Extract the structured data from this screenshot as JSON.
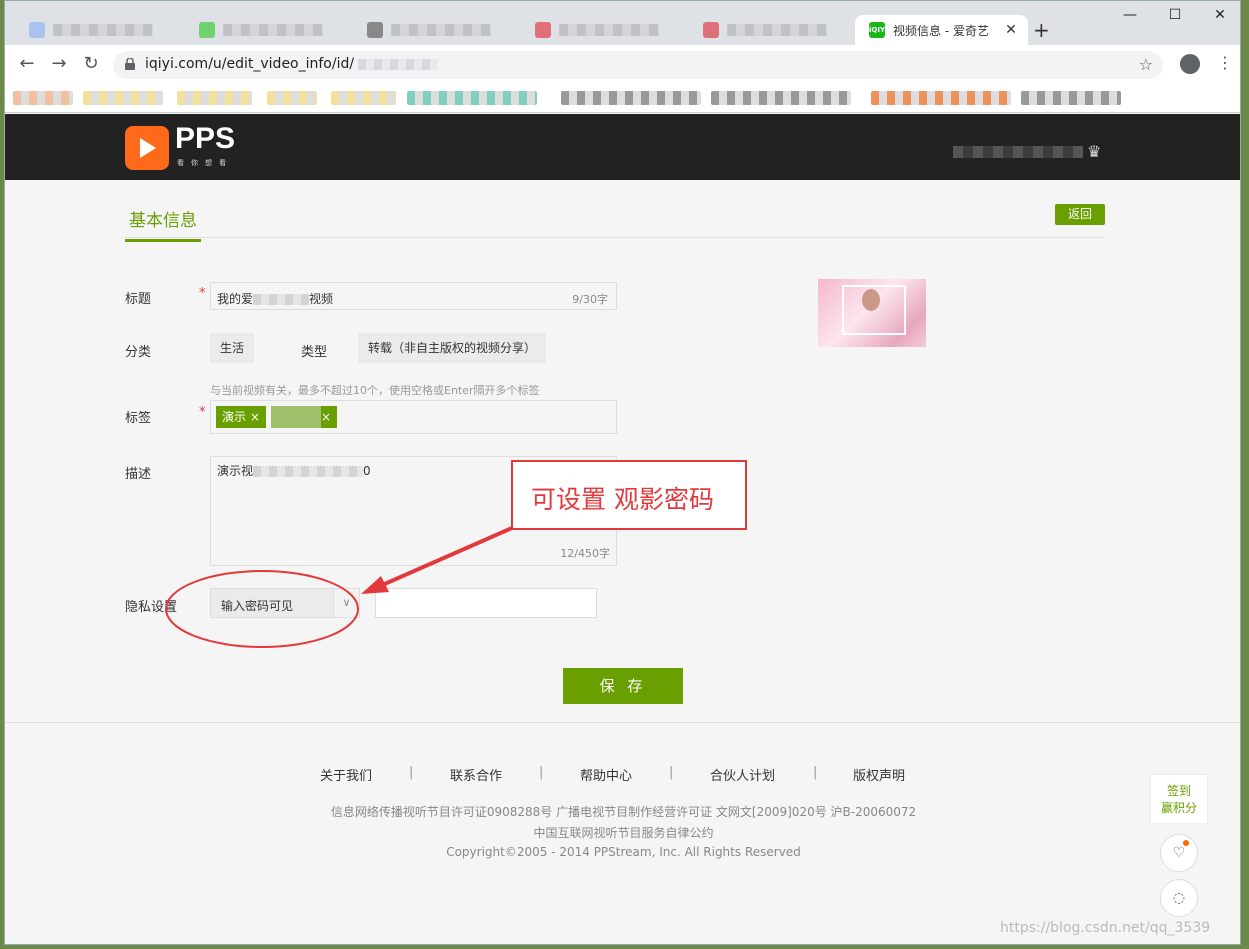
{
  "browser": {
    "active_tab_title": "视频信息 - 爱奇艺",
    "active_tab_favicon": "iQIYI",
    "url": "iqiyi.com/u/edit_video_info/id/",
    "window_controls": {
      "minimize": "—",
      "maximize": "☐",
      "close": "✕"
    },
    "new_tab": "+"
  },
  "site": {
    "logo": "PPS",
    "logo_tagline": "看你想看"
  },
  "page": {
    "section_title": "基本信息",
    "back_button": "返回"
  },
  "form": {
    "title_label": "标题",
    "title_value": "我的爱",
    "title_value_tail": "视频",
    "title_counter": "9/30字",
    "category_label": "分类",
    "category_value": "生活",
    "type_label": "类型",
    "type_value": "转载（非自主版权的视频分享）",
    "tags_hint": "与当前视频有关，最多不超过10个，使用空格或Enter隔开多个标签",
    "tags_label": "标签",
    "tags": [
      "演示 ×",
      "×"
    ],
    "desc_label": "描述",
    "desc_value": "演示视",
    "desc_value_tail": "0",
    "desc_counter": "12/450字",
    "privacy_label": "隐私设置",
    "privacy_value": "输入密码可见",
    "password_value": "",
    "required_mark": "*",
    "save_button": "保 存"
  },
  "annotation": {
    "text": "可设置  观影密码",
    "color": "#e4393c"
  },
  "footer": {
    "links": [
      "关于我们",
      "联系合作",
      "帮助中心",
      "合伙人计划",
      "版权声明"
    ],
    "separator": "|",
    "license_line": "信息网络传播视听节目许可证0908288号  广播电视节目制作经营许可证  文网文[2009]020号  沪B-20060072",
    "union_line": "中国互联网视听节目服务自律公约",
    "copyright": "Copyright©2005 - 2014 PPStream, Inc. All Rights Reserved"
  },
  "side": {
    "sign_line1": "签到",
    "sign_line2": "赢积分"
  },
  "watermark": "https://blog.csdn.net/qq_3539",
  "colors": {
    "brand_green": "#699f00",
    "header_bg": "#222222",
    "logo_orange": "#ff6a1a"
  }
}
